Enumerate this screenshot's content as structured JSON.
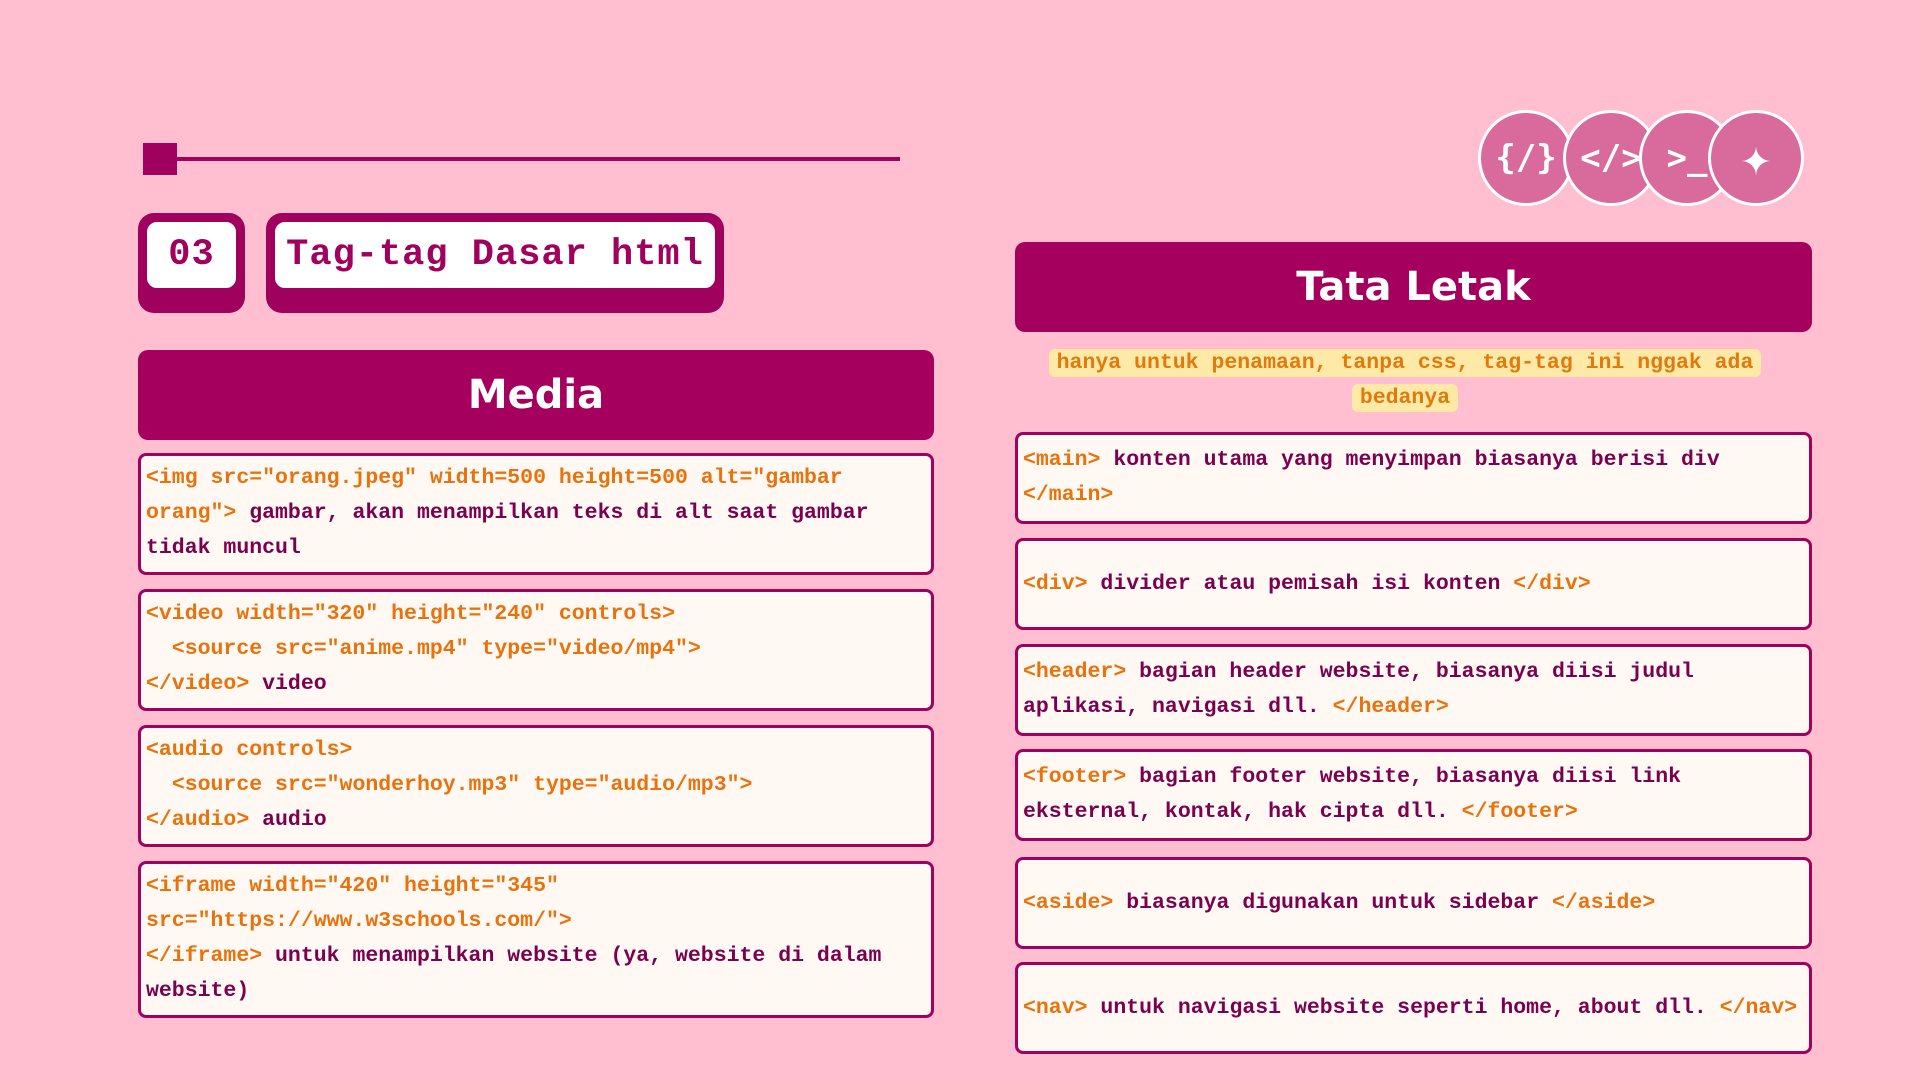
{
  "badge": {
    "number": "03",
    "title": "Tag-tag Dasar html"
  },
  "icons": [
    {
      "name": "braces-icon",
      "glyph": "{/}"
    },
    {
      "name": "code-tag-icon",
      "glyph": "</>"
    },
    {
      "name": "terminal-prompt-icon",
      "glyph": ">_"
    },
    {
      "name": "sparkle-icon",
      "glyph": "✦"
    }
  ],
  "colors": {
    "background": "#ffbfd0",
    "primary": "#a0005e",
    "code": "#e8720c",
    "highlight": "#ffe9a6"
  },
  "media": {
    "title": "Media",
    "items": [
      {
        "code": "<img src=\"orang.jpeg\" width=500 height=500 alt=\"gambar orang\">",
        "desc": " gambar, akan menampilkan teks di alt saat gambar tidak muncul"
      },
      {
        "code": "<video width=\"320\" height=\"240\" controls>\n  <source src=\"anime.mp4\" type=\"video/mp4\">\n</video>",
        "desc": " video"
      },
      {
        "code": "<audio controls>\n  <source src=\"wonderhoy.mp3\" type=\"audio/mp3\">\n</audio>",
        "desc": " audio"
      },
      {
        "code": "<iframe width=\"420\" height=\"345\"\nsrc=\"https://www.w3schools.com/\">\n</iframe>",
        "desc": " untuk menampilkan website (ya, website di dalam website)"
      }
    ]
  },
  "layout": {
    "title": "Tata Letak",
    "note": "hanya untuk penamaan, tanpa css, tag-tag ini nggak ada bedanya",
    "items": [
      {
        "open": "<main>",
        "desc": " konten utama yang menyimpan biasanya berisi div ",
        "close": "</main>"
      },
      {
        "open": "<div>",
        "desc": " divider atau pemisah isi konten ",
        "close": "</div>"
      },
      {
        "open": "<header>",
        "desc": " bagian header website, biasanya diisi judul aplikasi, navigasi dll. ",
        "close": "</header>"
      },
      {
        "open": "<footer>",
        "desc": " bagian footer website, biasanya diisi link eksternal, kontak, hak cipta dll. ",
        "close": "</footer>"
      },
      {
        "open": "<aside>",
        "desc": " biasanya digunakan untuk sidebar ",
        "close": "</aside>"
      },
      {
        "open": "<nav>",
        "desc": " untuk navigasi website seperti home, about dll. ",
        "close": "</nav>"
      }
    ]
  }
}
